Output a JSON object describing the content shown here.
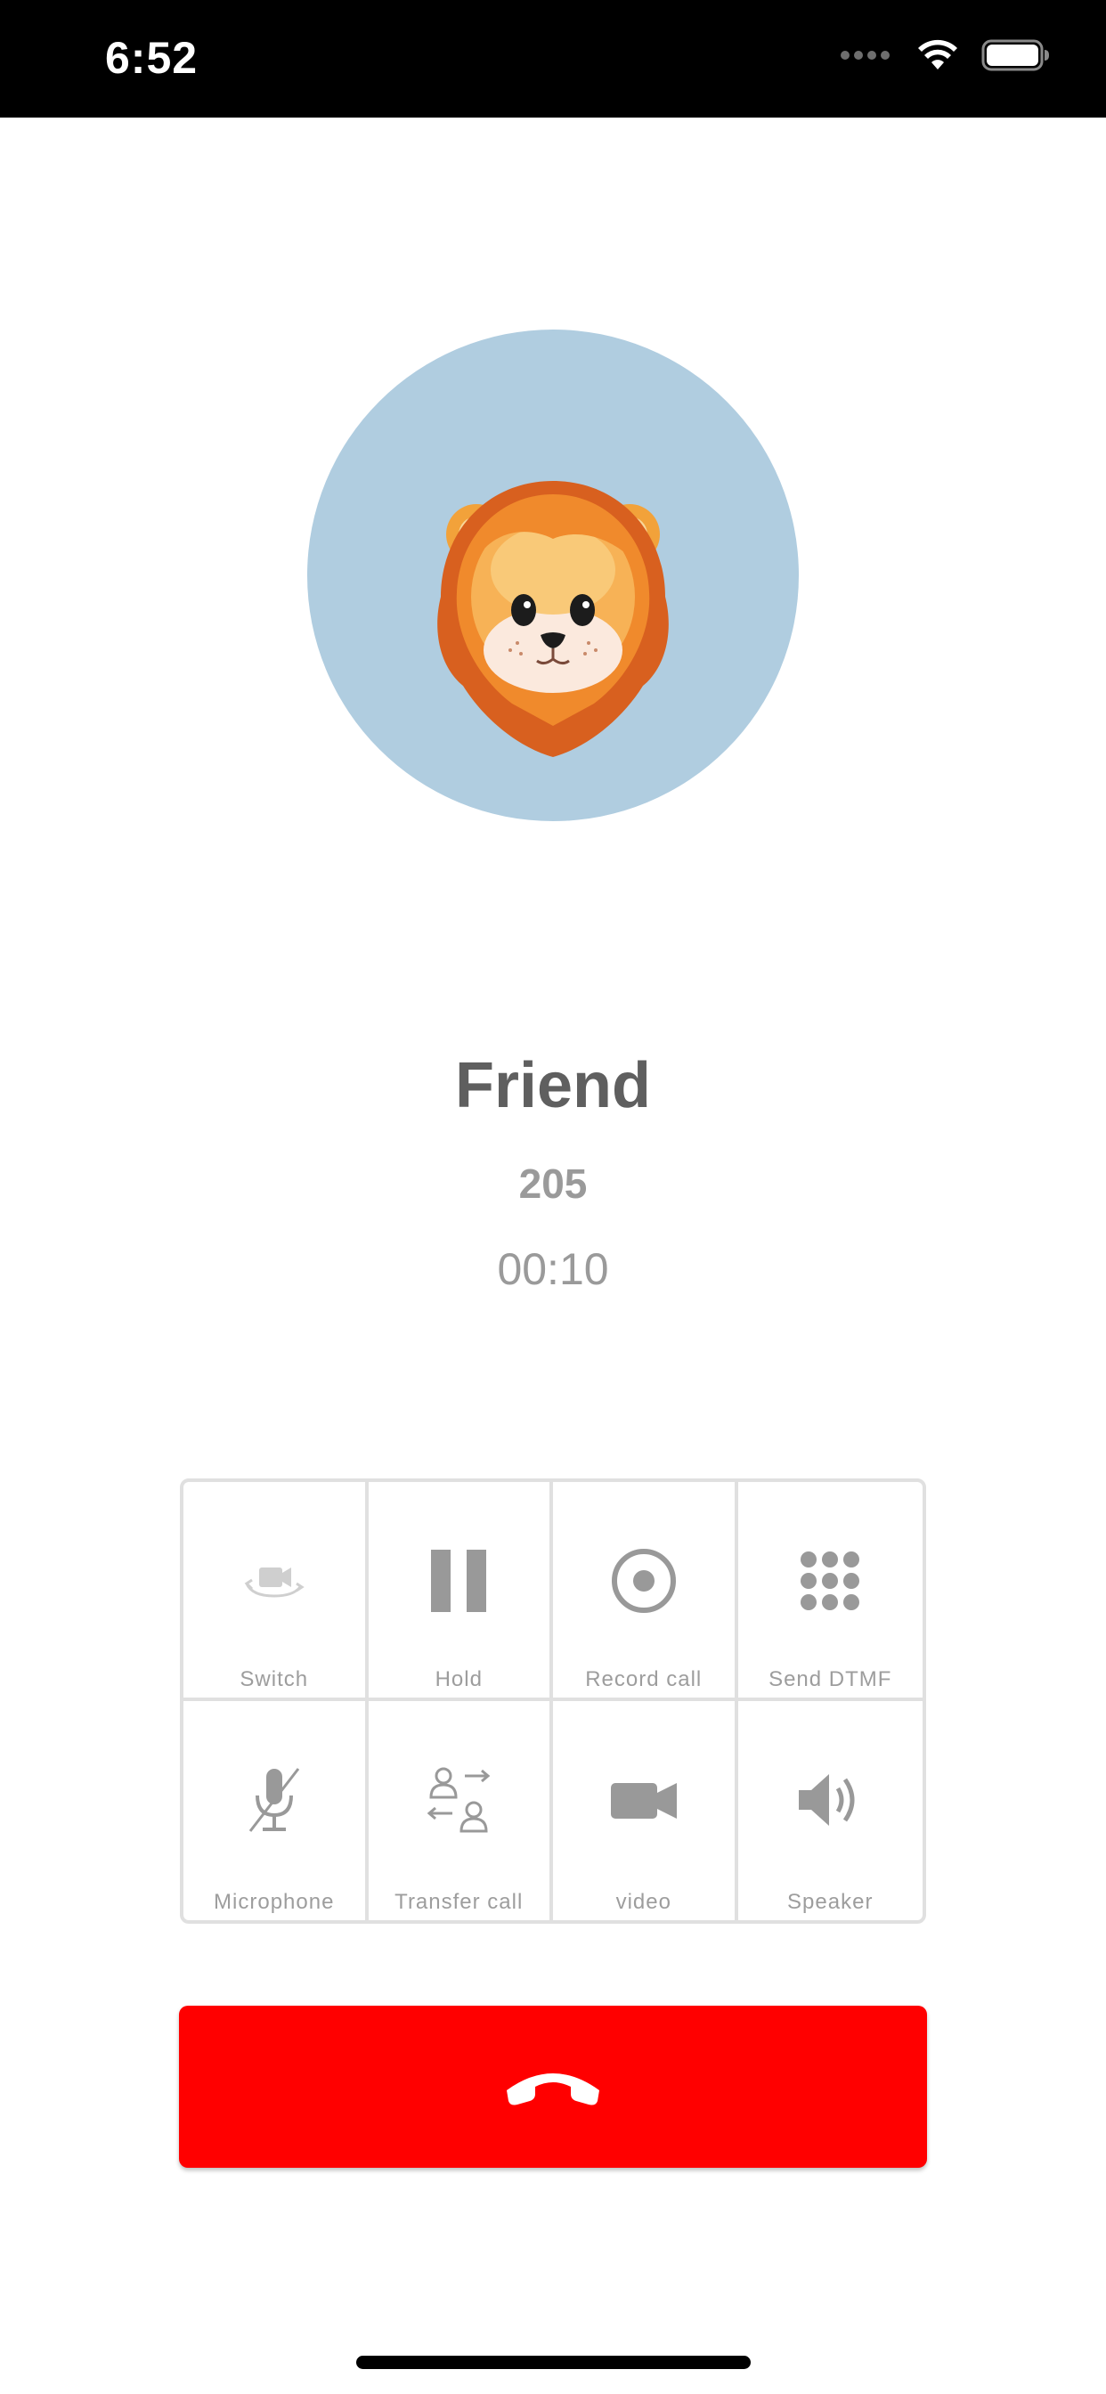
{
  "status_bar": {
    "time": "6:52"
  },
  "caller": {
    "avatar_icon": "lion-emoji-icon",
    "name": "Friend",
    "number": "205",
    "duration": "00:10"
  },
  "controls": [
    {
      "label": "Switch",
      "icon": "switch-camera-icon"
    },
    {
      "label": "Hold",
      "icon": "pause-icon"
    },
    {
      "label": "Record call",
      "icon": "record-icon"
    },
    {
      "label": "Send DTMF",
      "icon": "dialpad-icon"
    },
    {
      "label": "Microphone",
      "icon": "microphone-muted-icon"
    },
    {
      "label": "Transfer call",
      "icon": "transfer-call-icon"
    },
    {
      "label": "video",
      "icon": "video-camera-icon"
    },
    {
      "label": "Speaker",
      "icon": "speaker-icon"
    }
  ],
  "end_call": {
    "icon": "hang-up-icon"
  },
  "colors": {
    "status_bar_bg": "#000000",
    "avatar_bg": "#b0cde0",
    "end_call_bg": "#ff0000",
    "text_primary": "#5f5f5f",
    "text_secondary": "#9a9a9a",
    "grid_border": "#e0e0e0",
    "icon_gray": "#999999"
  }
}
